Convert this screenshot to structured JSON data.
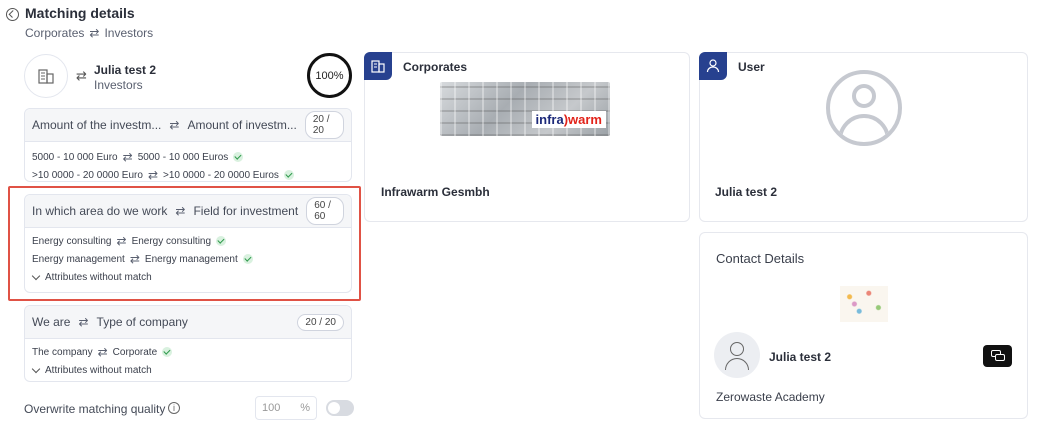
{
  "header": {
    "title": "Matching details",
    "left_label": "Corporates",
    "right_label": "Investors",
    "arrows": "⇄"
  },
  "profile": {
    "name": "Julia test 2",
    "role": "Investors",
    "match_percent": "100%"
  },
  "criteria": [
    {
      "left": "Amount of the investm...",
      "right": "Amount of investm...",
      "score": "20 / 20",
      "rows": [
        {
          "left": "5000 - 10 000 Euro",
          "right": "5000 - 10 000 Euros"
        },
        {
          "left": ">10 0000 - 20 0000 Euro",
          "right": ">10 0000 - 20 0000 Euros"
        }
      ]
    },
    {
      "left": "In which area do we work",
      "right": "Field for investment",
      "score": "60 / 60",
      "rows": [
        {
          "left": "Energy consulting",
          "right": "Energy consulting"
        },
        {
          "left": "Energy management",
          "right": "Energy management"
        }
      ],
      "attributes_label": "Attributes without match"
    },
    {
      "left": "We are",
      "right": "Type of company",
      "score": "20 / 20",
      "rows": [
        {
          "left": "The company",
          "right": "Corporate"
        }
      ],
      "attributes_label": "Attributes without match"
    }
  ],
  "overwrite": {
    "label": "Overwrite matching quality",
    "info": "i",
    "value_placeholder": "100",
    "unit": "%"
  },
  "corporates_panel": {
    "title": "Corporates",
    "company_name": "Infrawarm Gesmbh",
    "logo_text_a": "infra",
    "logo_text_b": ")warm"
  },
  "user_panel": {
    "title": "User",
    "name": "Julia test 2"
  },
  "contact_panel": {
    "title": "Contact Details",
    "name": "Julia test 2",
    "company": "Zerowaste Academy"
  },
  "colors": {
    "accent": "#27418f",
    "highlight": "#e05245",
    "match_green": "#2f9a4c"
  }
}
